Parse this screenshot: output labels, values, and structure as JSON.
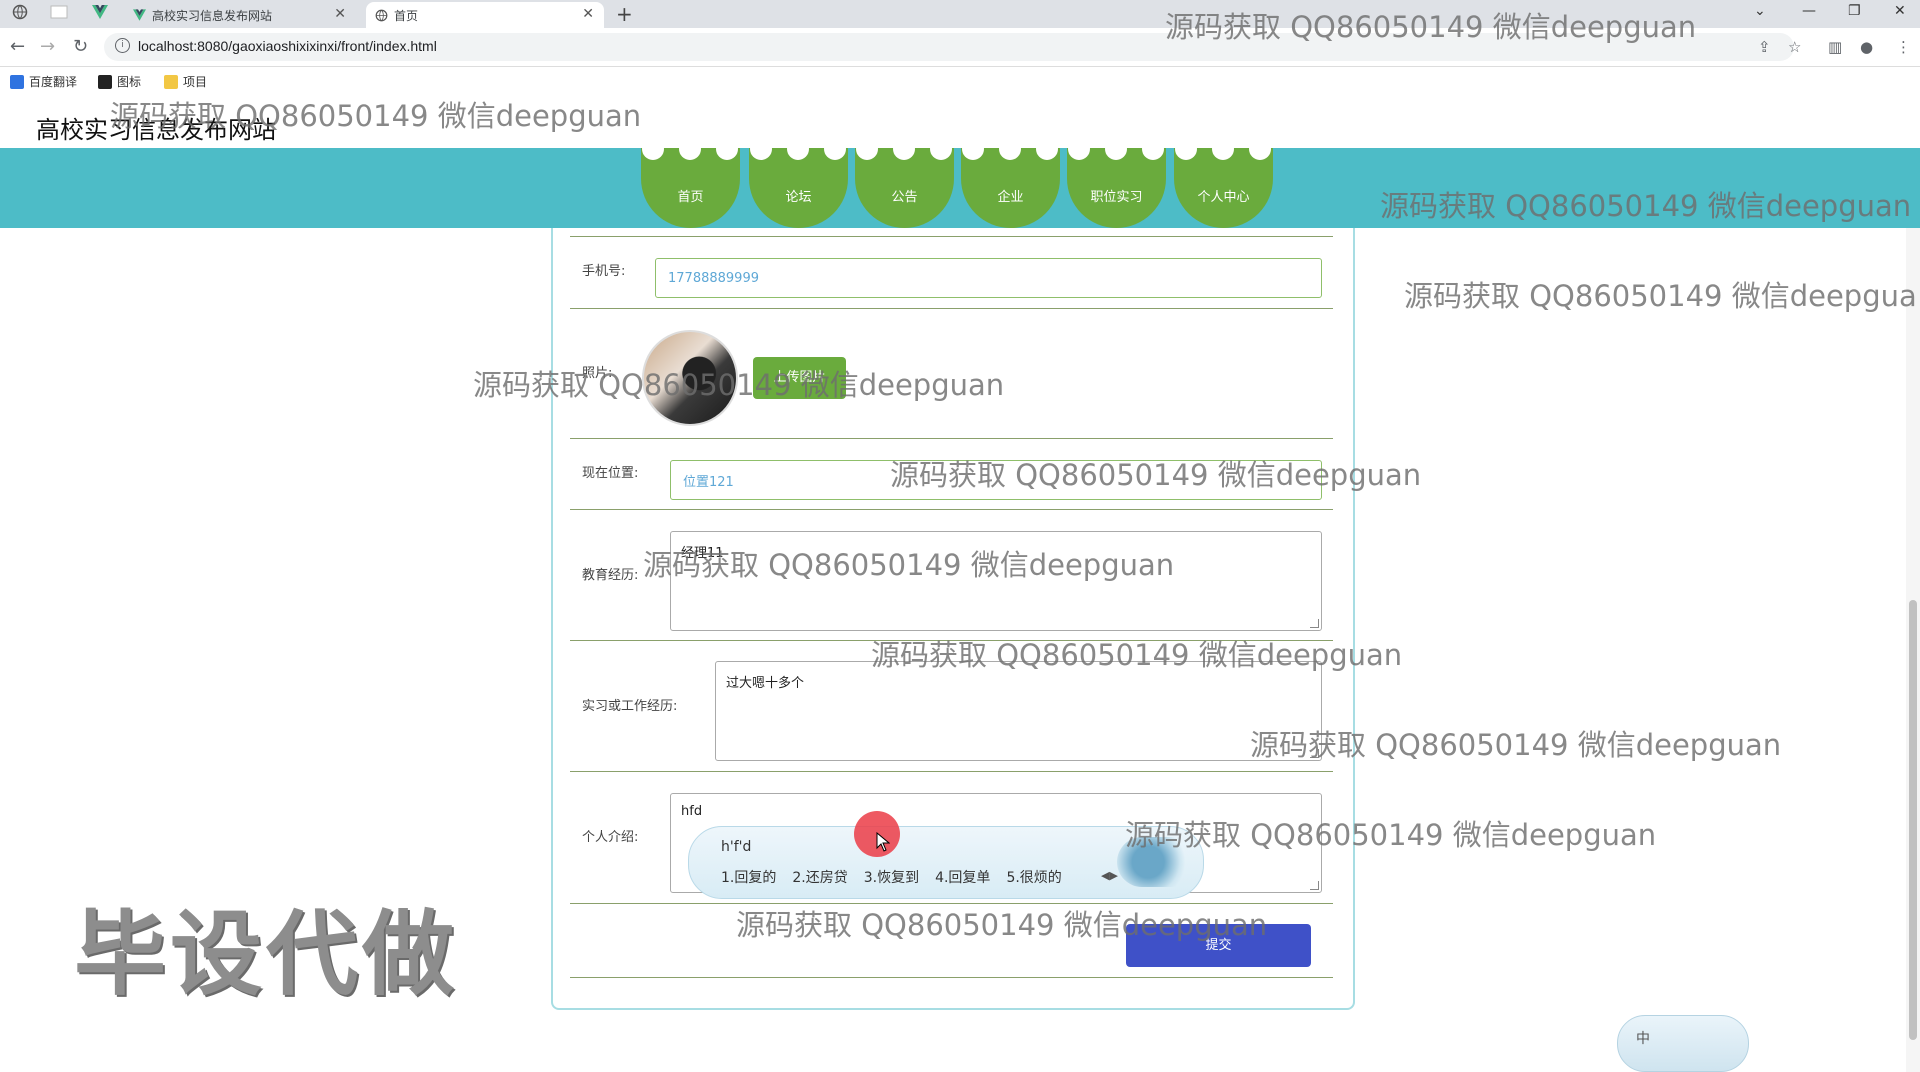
{
  "browser": {
    "tabs": [
      {
        "title": "高校实习信息发布网站"
      },
      {
        "title": "首页"
      }
    ],
    "url": "localhost:8080/gaoxiaoshixixinxi/front/index.html",
    "bookmarks": [
      "百度翻译",
      "图标",
      "项目"
    ]
  },
  "site": {
    "title": "高校实习信息发布网站",
    "nav": [
      "首页",
      "论坛",
      "公告",
      "企业",
      "职位实习",
      "个人中心"
    ]
  },
  "form": {
    "phone_label": "手机号:",
    "phone_value": "17788889999",
    "photo_label": "照片:",
    "upload_label": "上传图片",
    "location_label": "现在位置:",
    "location_value": "位置121",
    "education_label": "教育经历:",
    "education_value": "经理11",
    "work_label": "实习或工作经历:",
    "work_value": "过大嗯十多个",
    "intro_label": "个人介绍:",
    "intro_value": "hfd",
    "submit_label": "提交"
  },
  "ime": {
    "composition": "h'f'd",
    "candidates": [
      "1.回复的",
      "2.还房贷",
      "3.恢复到",
      "4.回复单",
      "5.很烦的"
    ],
    "status": "中"
  },
  "watermarks": {
    "text": "源码获取 QQ86050149 微信deepguan",
    "clipped": "源码获取 QQ86050149 微信deepgua",
    "big": "毕设代做"
  }
}
